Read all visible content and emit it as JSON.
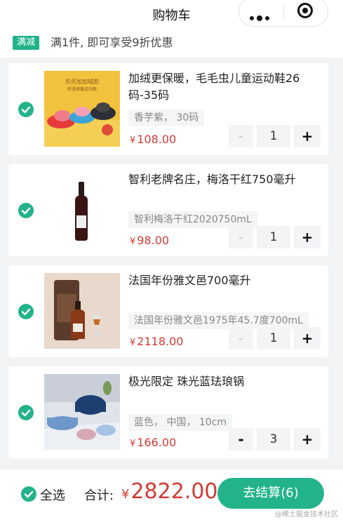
{
  "header": {
    "title": "购物车"
  },
  "promo": {
    "tag": "满减",
    "text": "满1件, 即可享受9折优惠"
  },
  "colors": {
    "accent": "#23b38b",
    "price": "#d33a34"
  },
  "items": [
    {
      "name": "加绒更保暖，毛毛虫儿童运动鞋26码-35码",
      "spec": "香芋紫， 30码",
      "yen": "¥",
      "price": "108.00",
      "qty": "1",
      "checked": true,
      "minus": "-",
      "plus": "+"
    },
    {
      "name": "智利老牌名庄，梅洛干红750毫升",
      "spec": "智利梅洛干红2020750mL",
      "yen": "¥",
      "price": "98.00",
      "qty": "1",
      "checked": true,
      "minus": "-",
      "plus": "+"
    },
    {
      "name": "法国年份雅文邑700毫升",
      "spec": "法国年份雅文邑1975年45.7度700mL",
      "yen": "¥",
      "price": "2118.00",
      "qty": "1",
      "checked": true,
      "minus": "-",
      "plus": "+"
    },
    {
      "name": "极光限定 珠光蓝珐琅锅",
      "spec": "蓝色， 中国， 10cm",
      "yen": "¥",
      "price": "166.00",
      "qty": "3",
      "checked": true,
      "minus": "-",
      "plus": "+"
    }
  ],
  "footer": {
    "select_all": "全选",
    "sum_label": "合计:",
    "yen": "¥",
    "total": "2822.00",
    "checkout": "去结算(6)"
  },
  "watermark": "@稀土掘金技术社区"
}
